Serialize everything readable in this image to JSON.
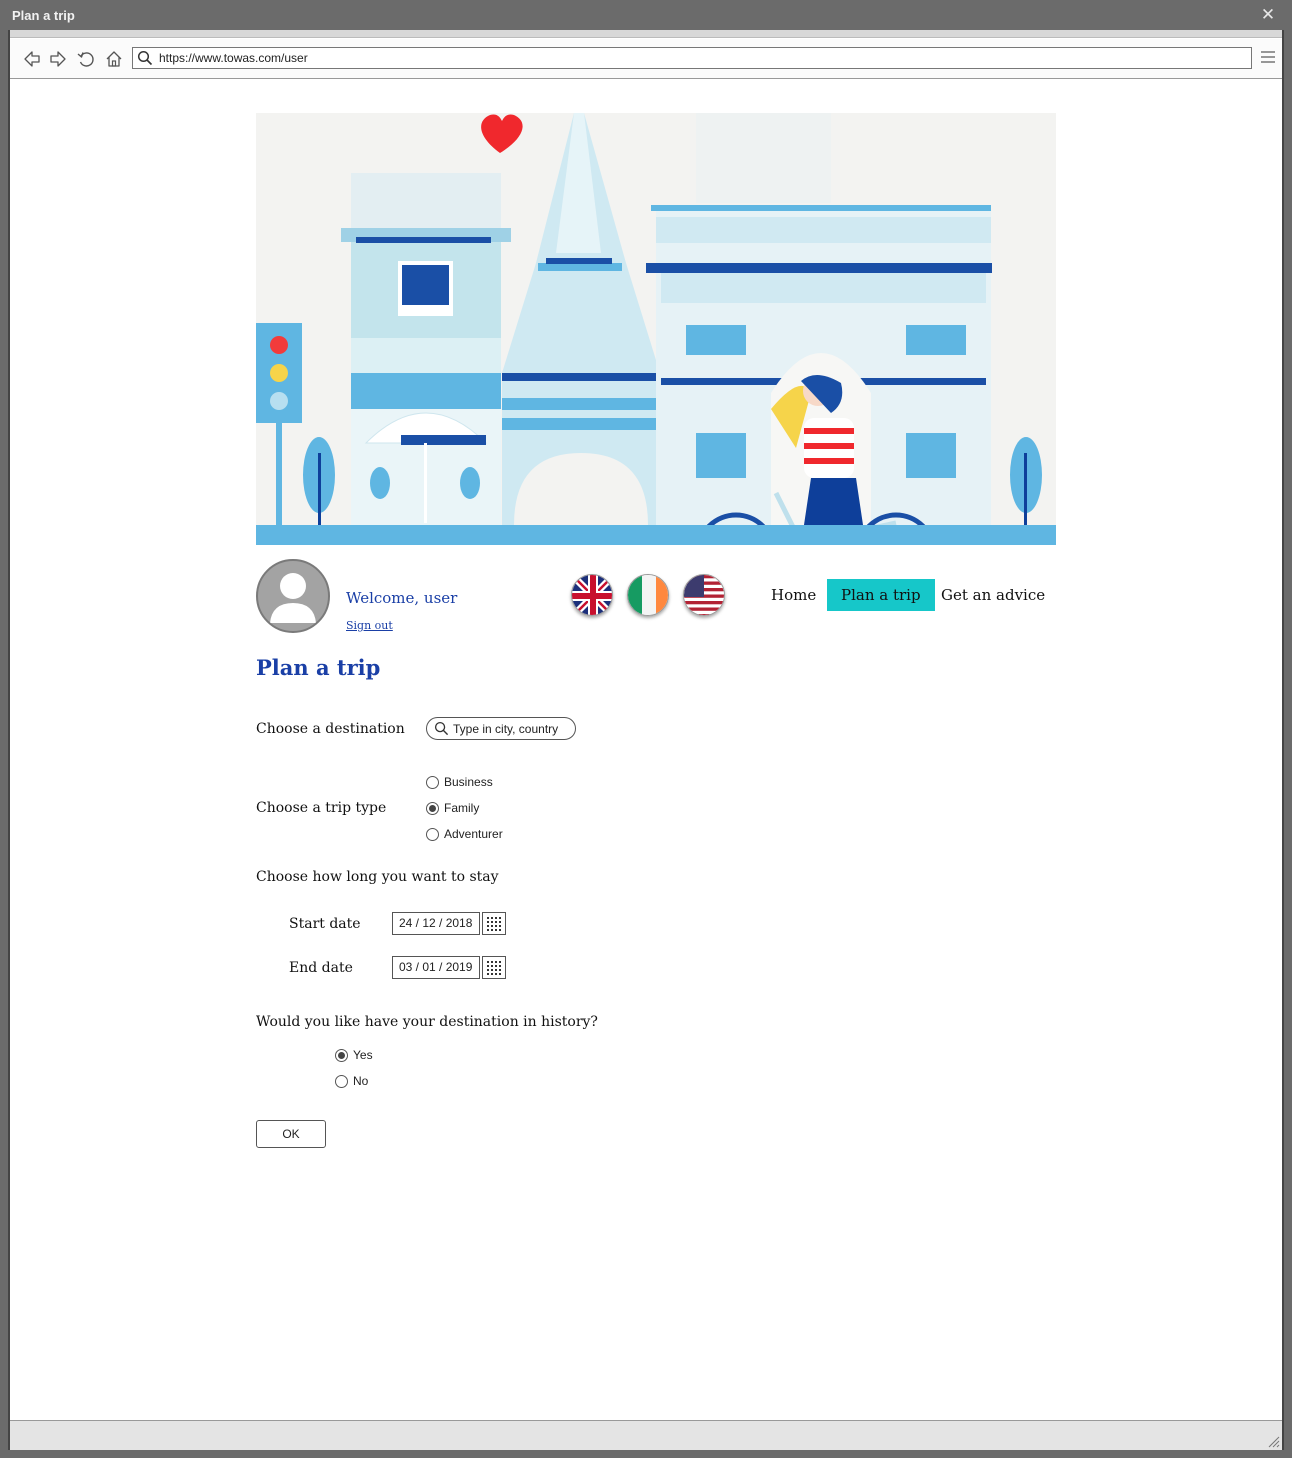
{
  "window": {
    "title": "Plan a trip"
  },
  "browser": {
    "url": "https://www.towas.com/user"
  },
  "user": {
    "welcome": "Welcome, user",
    "sign_out": "Sign out"
  },
  "languages": [
    {
      "name": "uk-flag"
    },
    {
      "name": "ireland-flag"
    },
    {
      "name": "us-flag"
    }
  ],
  "nav": {
    "home": "Home",
    "plan_trip": "Plan a trip",
    "advice": "Get an advice",
    "active": "plan_trip",
    "active_color": "#16c7c9"
  },
  "page": {
    "title": "Plan a trip"
  },
  "destination": {
    "label": "Choose a destination",
    "placeholder": "Type in city, country"
  },
  "trip_type": {
    "label": "Choose a trip type",
    "options": [
      "Business",
      "Family",
      "Adventurer"
    ],
    "selected": "Family"
  },
  "stay": {
    "label": "Choose how long you want to stay",
    "start_label": "Start date",
    "start_value": "24 / 12 / 2018",
    "end_label": "End date",
    "end_value": "03 / 01 / 2019"
  },
  "history": {
    "question": "Would you like have your destination in history?",
    "options": [
      "Yes",
      "No"
    ],
    "selected": "Yes"
  },
  "actions": {
    "ok": "OK"
  },
  "colors": {
    "accent": "#16c7c9",
    "link": "#1a3fa6",
    "chrome": "#6b6b6b"
  }
}
